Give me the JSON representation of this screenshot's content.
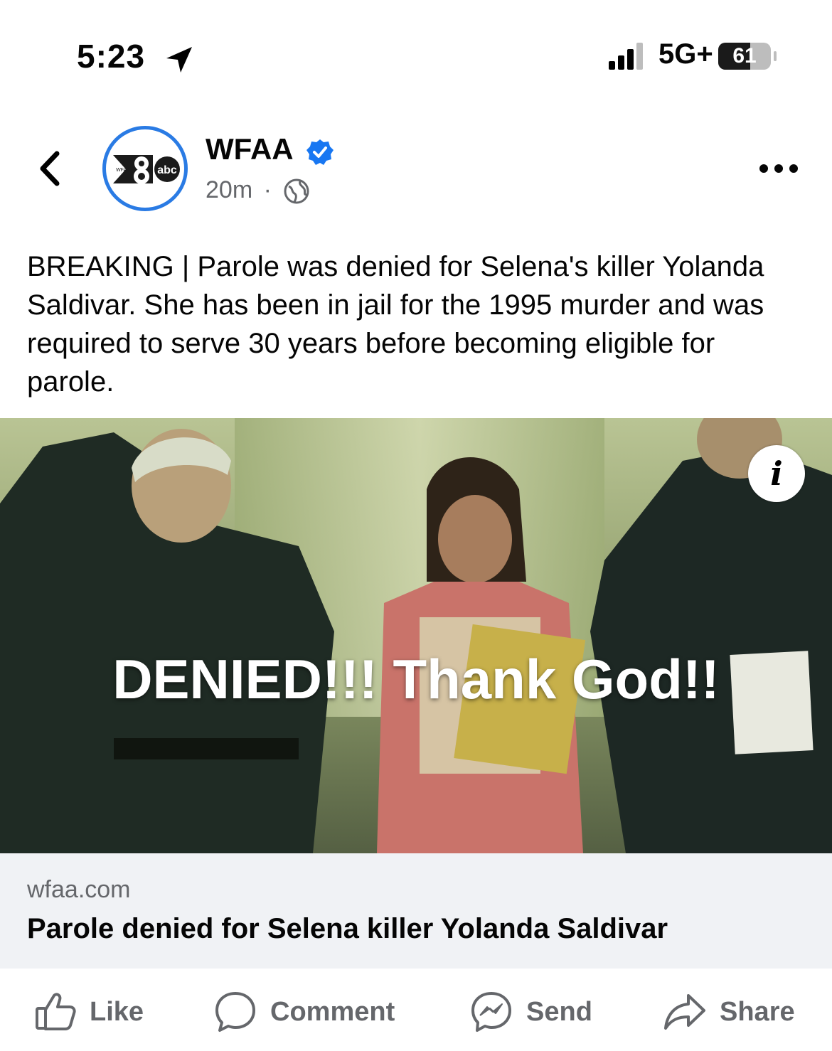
{
  "status_bar": {
    "time": "5:23",
    "network": "5G+",
    "battery": "61",
    "battery_level": 0.61
  },
  "header": {
    "page_name": "WFAA",
    "time_ago": "20m",
    "separator": "·",
    "logo_small_text": "WFAA",
    "logo_network": "abc"
  },
  "post": {
    "text": "BREAKING | Parole was denied for Selena's killer Yolanda Saldivar. She has been in jail for the 1995 murder and was required to serve 30 years before becoming eligible for parole.",
    "overlay_text": "DENIED!!! Thank God!!",
    "info_icon": "i"
  },
  "link": {
    "domain": "wfaa.com",
    "title": "Parole denied for Selena killer Yolanda Saldivar"
  },
  "actions": {
    "like": "Like",
    "comment": "Comment",
    "send": "Send",
    "share": "Share"
  },
  "colors": {
    "accent": "#2a7be4",
    "text": "#050505",
    "muted": "#65676b",
    "link_bg": "#f0f2f5"
  }
}
